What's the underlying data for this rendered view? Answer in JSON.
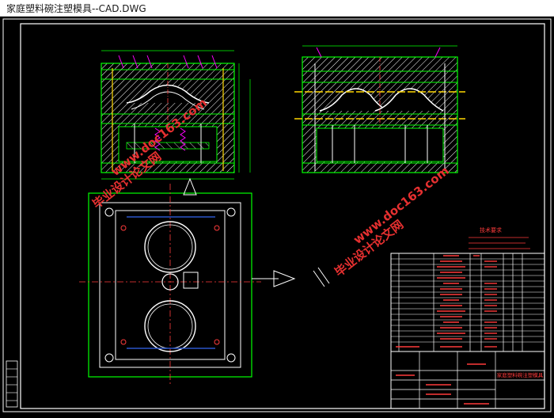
{
  "window": {
    "title": "家庭塑料碗注塑模具--CAD.DWG"
  },
  "watermarks": {
    "site_name": "毕业设计论文网",
    "site_url": "www.doc163.com"
  },
  "tech_requirements": {
    "heading": "技术要求"
  },
  "title_block": {
    "drawing_title": "家庭塑料碗注塑模具"
  },
  "colors": {
    "background": "#000000",
    "frame": "#ffffff",
    "outline": "#00ff00",
    "hatch": "#ffffff",
    "centerline": "#ff3b3b",
    "parts": "#ff00ff",
    "pins": "#ffd800",
    "dimension": "#00ffff",
    "table_text": "#ff3b3b",
    "watermark_red": "#e63030",
    "watermark_blue": "#2a54c8"
  }
}
